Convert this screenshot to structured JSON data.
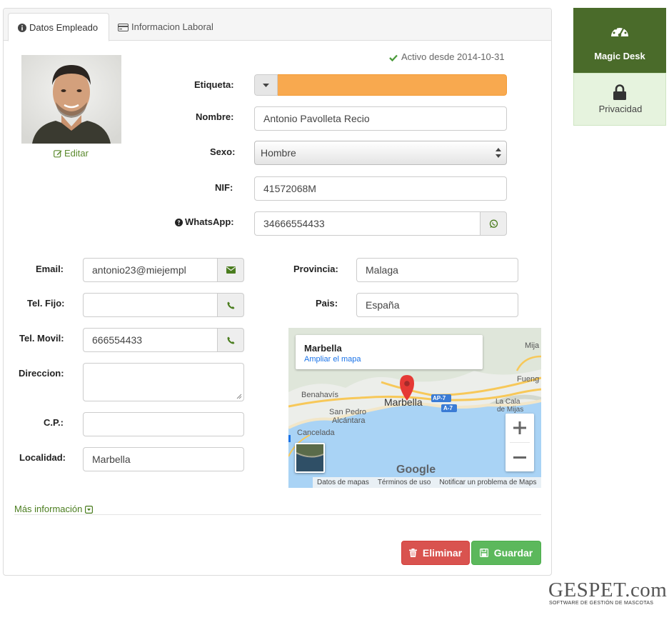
{
  "tabs": [
    {
      "label": "Datos Empleado",
      "active": true,
      "icon": "info-circle-icon"
    },
    {
      "label": "Informacion Laboral",
      "active": false,
      "icon": "credit-card-icon"
    }
  ],
  "profile": {
    "edit_label": "Editar",
    "status": "Activo desde 2014-10-31"
  },
  "form": {
    "etiqueta": {
      "label": "Etiqueta:",
      "color": "#f8a94f"
    },
    "nombre": {
      "label": "Nombre:",
      "value": "Antonio Pavolleta Recio"
    },
    "sexo": {
      "label": "Sexo:",
      "value": "Hombre"
    },
    "nif": {
      "label": "NIF:",
      "value": "41572068M"
    },
    "whatsapp": {
      "label": "WhatsApp:",
      "value": "34666554433"
    },
    "email": {
      "label": "Email:",
      "value": "antonio23@miejempl"
    },
    "tel_fijo": {
      "label": "Tel. Fijo:",
      "value": ""
    },
    "tel_movil": {
      "label": "Tel. Movil:",
      "value": "666554433"
    },
    "direccion": {
      "label": "Direccion:",
      "value": ""
    },
    "cp": {
      "label": "C.P.:",
      "value": ""
    },
    "localidad": {
      "label": "Localidad:",
      "value": "Marbella"
    },
    "provincia": {
      "label": "Provincia:",
      "value": "Malaga"
    },
    "pais": {
      "label": "Pais:",
      "value": "España"
    }
  },
  "map": {
    "place": "Marbella",
    "enlarge_link": "Ampliar el mapa",
    "labels": {
      "marbella": "Marbella",
      "benahavis": "Benahavís",
      "san_pedro": "San Pedro",
      "alcantara": "Alcántara",
      "cancelada": "Cancelada",
      "mijas": "Mija",
      "fuengirola": "Fueng",
      "la_cala": "La Cala",
      "de_mijas": "de Mijas",
      "ap7": "AP-7",
      "a7": "A-7"
    },
    "google": "Google",
    "footer": [
      "Datos de mapas",
      "Términos de uso",
      "Notificar un problema de Maps"
    ]
  },
  "more_info": "Más información",
  "buttons": {
    "delete": "Eliminar",
    "save": "Guardar"
  },
  "sidebar": [
    {
      "label": "Magic Desk",
      "icon": "dashboard-gauge-icon"
    },
    {
      "label": "Privacidad",
      "icon": "lock-icon"
    }
  ],
  "brand": {
    "name": "GESPET.com",
    "tagline": "SOFTWARE DE GESTIÓN DE MASCOTAS"
  },
  "colors": {
    "accent_green": "#4a6b2a",
    "danger": "#d9534f",
    "success": "#5cb85c"
  }
}
